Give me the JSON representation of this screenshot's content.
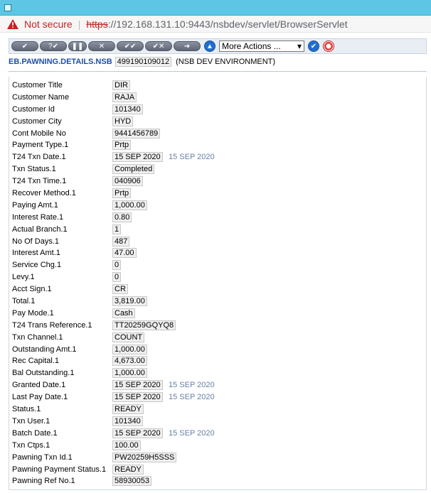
{
  "browser": {
    "not_secure": "Not secure",
    "url_scheme": "https",
    "url_rest": "://192.168.131.10:9443/nsbdev/servlet/BrowserServlet"
  },
  "toolbar": {
    "more_actions": "More Actions ..."
  },
  "header": {
    "app": "EB.PAWNING.DETAILS.NSB",
    "record_id": "499190109012",
    "environment": "(NSB DEV ENVIRONMENT)"
  },
  "fields": [
    {
      "label": "Customer Title",
      "value": "DIR"
    },
    {
      "label": "Customer Name",
      "value": "RAJA"
    },
    {
      "label": "Customer Id",
      "value": "101340"
    },
    {
      "label": "Customer City",
      "value": "HYD"
    },
    {
      "label": "Cont Mobile No",
      "value": "9441456789"
    },
    {
      "label": "Payment Type.1",
      "value": "Prtp"
    },
    {
      "label": "T24 Txn Date.1",
      "value": "15 SEP 2020",
      "extra": "15 SEP 2020"
    },
    {
      "label": "Txn Status.1",
      "value": "Completed"
    },
    {
      "label": "T24 Txn Time.1",
      "value": "040906"
    },
    {
      "label": "Recover Method.1",
      "value": "Prtp"
    },
    {
      "label": "Paying Amt.1",
      "value": "1,000.00"
    },
    {
      "label": "Interest Rate.1",
      "value": "0.80"
    },
    {
      "label": "Actual Branch.1",
      "value": "1"
    },
    {
      "label": "No Of Days.1",
      "value": "487"
    },
    {
      "label": "Interest Amt.1",
      "value": "47.00"
    },
    {
      "label": "Service Chg.1",
      "value": "0"
    },
    {
      "label": "Levy.1",
      "value": "0"
    },
    {
      "label": "Acct Sign.1",
      "value": "CR"
    },
    {
      "label": "Total.1",
      "value": "3,819.00"
    },
    {
      "label": "Pay Mode.1",
      "value": "Cash"
    },
    {
      "label": "T24 Trans Reference.1",
      "value": "TT20259GQYQ8"
    },
    {
      "label": "Txn Channel.1",
      "value": "COUNT"
    },
    {
      "label": "Outstanding Amt.1",
      "value": "1,000.00"
    },
    {
      "label": "Rec Capital.1",
      "value": "4,673.00"
    },
    {
      "label": "Bal Outstanding.1",
      "value": "1,000.00"
    },
    {
      "label": "Granted Date.1",
      "value": "15 SEP 2020",
      "extra": "15 SEP 2020"
    },
    {
      "label": "Last Pay Date.1",
      "value": "15 SEP 2020",
      "extra": "15 SEP 2020"
    },
    {
      "label": "Status.1",
      "value": "READY"
    },
    {
      "label": "Txn User.1",
      "value": "101340"
    },
    {
      "label": "Batch Date.1",
      "value": "15 SEP 2020",
      "extra": "15 SEP 2020"
    },
    {
      "label": "Txn Ctps.1",
      "value": "100.00"
    },
    {
      "label": "Pawning Txn Id.1",
      "value": "PW20259H5SSS"
    },
    {
      "label": "Pawning Payment Status.1",
      "value": "READY"
    },
    {
      "label": "Pawning Ref No.1",
      "value": "58930053"
    }
  ]
}
